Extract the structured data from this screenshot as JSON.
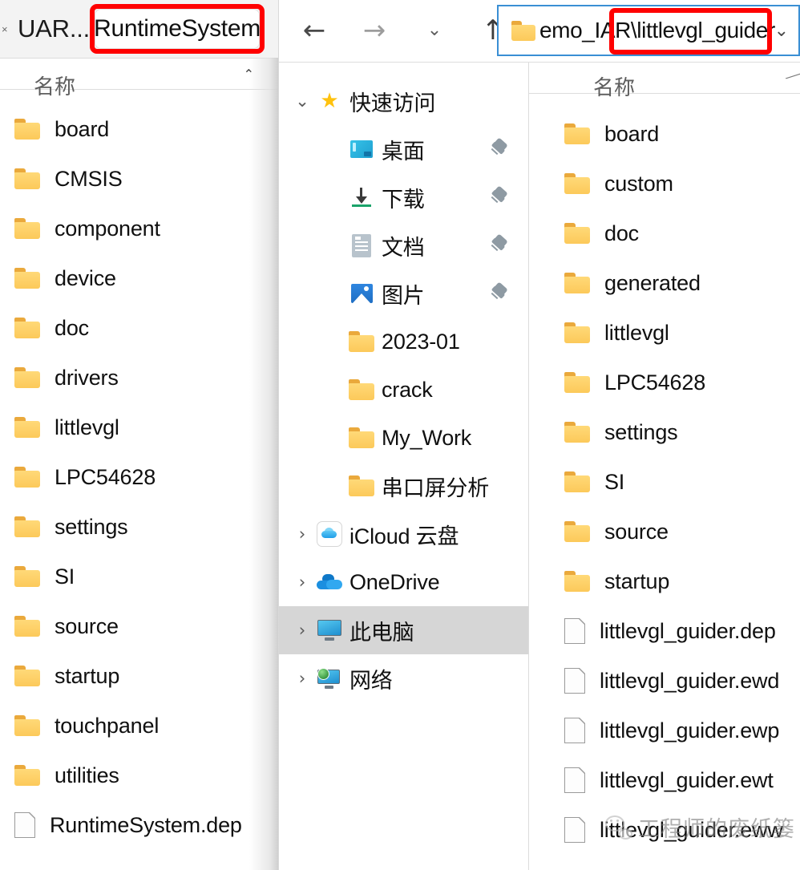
{
  "left_window": {
    "close_icon": "×",
    "inactive_tab_label": "UAR...",
    "tab_separator": ":",
    "active_tab_label": "RuntimeSystem",
    "column_header": "名称",
    "sort_caret": "⌃",
    "highlight_color": "#ff0000",
    "items": [
      {
        "name": "board",
        "type": "folder"
      },
      {
        "name": "CMSIS",
        "type": "folder"
      },
      {
        "name": "component",
        "type": "folder"
      },
      {
        "name": "device",
        "type": "folder"
      },
      {
        "name": "doc",
        "type": "folder"
      },
      {
        "name": "drivers",
        "type": "folder"
      },
      {
        "name": "littlevgl",
        "type": "folder"
      },
      {
        "name": "LPC54628",
        "type": "folder"
      },
      {
        "name": "settings",
        "type": "folder"
      },
      {
        "name": "SI",
        "type": "folder"
      },
      {
        "name": "source",
        "type": "folder"
      },
      {
        "name": "startup",
        "type": "folder"
      },
      {
        "name": "touchpanel",
        "type": "folder"
      },
      {
        "name": "utilities",
        "type": "folder"
      },
      {
        "name": "RuntimeSystem.dep",
        "type": "file"
      }
    ]
  },
  "toolbar": {
    "back_icon": "←",
    "forward_icon": "→",
    "recent_icon": "⌄",
    "up_icon": "↑",
    "address_value": "emo_IAR\\littlevgl_guider",
    "address_dropdown_icon": "⌄",
    "highlight_color": "#ff0000"
  },
  "navpane": {
    "items": [
      {
        "label": "快速访问",
        "icon": "star-icon",
        "twisty": "expanded",
        "indent": 0,
        "pinned": false,
        "selected": false
      },
      {
        "label": "桌面",
        "icon": "desktop-icon",
        "twisty": "none",
        "indent": 1,
        "pinned": true,
        "selected": false
      },
      {
        "label": "下载",
        "icon": "downloads-icon",
        "twisty": "none",
        "indent": 1,
        "pinned": true,
        "selected": false
      },
      {
        "label": "文档",
        "icon": "documents-icon",
        "twisty": "none",
        "indent": 1,
        "pinned": true,
        "selected": false
      },
      {
        "label": "图片",
        "icon": "pictures-icon",
        "twisty": "none",
        "indent": 1,
        "pinned": true,
        "selected": false
      },
      {
        "label": "2023-01",
        "icon": "folder-icon",
        "twisty": "none",
        "indent": 1,
        "pinned": false,
        "selected": false
      },
      {
        "label": "crack",
        "icon": "folder-icon",
        "twisty": "none",
        "indent": 1,
        "pinned": false,
        "selected": false
      },
      {
        "label": "My_Work",
        "icon": "folder-icon",
        "twisty": "none",
        "indent": 1,
        "pinned": false,
        "selected": false
      },
      {
        "label": "串口屏分析",
        "icon": "folder-icon",
        "twisty": "none",
        "indent": 1,
        "pinned": false,
        "selected": false
      },
      {
        "label": "iCloud 云盘",
        "icon": "icloud-icon",
        "twisty": "collapsed",
        "indent": 0,
        "pinned": false,
        "selected": false
      },
      {
        "label": "OneDrive",
        "icon": "onedrive-icon",
        "twisty": "collapsed",
        "indent": 0,
        "pinned": false,
        "selected": false
      },
      {
        "label": "此电脑",
        "icon": "this-pc-icon",
        "twisty": "collapsed",
        "indent": 0,
        "pinned": false,
        "selected": true
      },
      {
        "label": "网络",
        "icon": "network-icon",
        "twisty": "collapsed",
        "indent": 0,
        "pinned": false,
        "selected": false
      }
    ],
    "twisty_expanded_glyph": "⌄",
    "twisty_collapsed_glyph": "›"
  },
  "right_pane": {
    "column_header": "名称",
    "items": [
      {
        "name": "board",
        "type": "folder"
      },
      {
        "name": "custom",
        "type": "folder"
      },
      {
        "name": "doc",
        "type": "folder"
      },
      {
        "name": "generated",
        "type": "folder"
      },
      {
        "name": "littlevgl",
        "type": "folder"
      },
      {
        "name": "LPC54628",
        "type": "folder"
      },
      {
        "name": "settings",
        "type": "folder"
      },
      {
        "name": "SI",
        "type": "folder"
      },
      {
        "name": "source",
        "type": "folder"
      },
      {
        "name": "startup",
        "type": "folder"
      },
      {
        "name": "littlevgl_guider.dep",
        "type": "file"
      },
      {
        "name": "littlevgl_guider.ewd",
        "type": "file"
      },
      {
        "name": "littlevgl_guider.ewp",
        "type": "file"
      },
      {
        "name": "littlevgl_guider.ewt",
        "type": "file"
      },
      {
        "name": "littlevgl_guider.eww",
        "type": "file"
      }
    ]
  },
  "watermark": {
    "text": "工程师的废纸篓"
  }
}
